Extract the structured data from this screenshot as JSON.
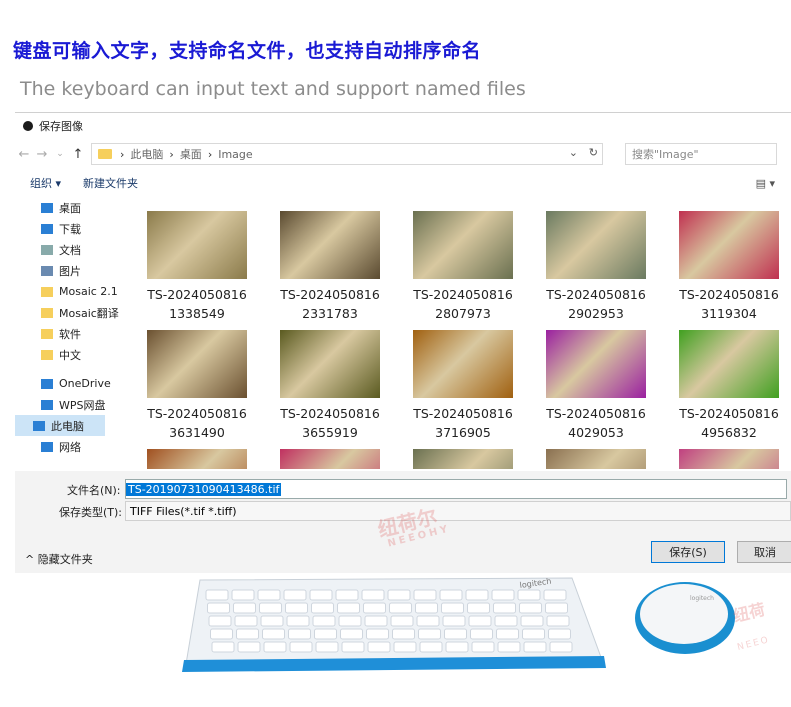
{
  "headline": "键盘可输入文字，支持命名文件，也支持自动排序命名",
  "subline": "The keyboard can input text and support named files",
  "dialog": {
    "title": "保存图像",
    "path": [
      "此电脑",
      "桌面",
      "Image"
    ],
    "search_placeholder": "搜索\"Image\"",
    "organize": "组织 ▾",
    "new_folder": "新建文件夹",
    "view_icon": "view-icon",
    "sidebar": [
      {
        "label": "桌面",
        "icon": "desktop-icon"
      },
      {
        "label": "下载",
        "icon": "download-icon"
      },
      {
        "label": "文档",
        "icon": "document-icon"
      },
      {
        "label": "图片",
        "icon": "picture-icon"
      },
      {
        "label": "Mosaic 2.1",
        "icon": "folder-icon"
      },
      {
        "label": "Mosaic翻译",
        "icon": "folder-icon"
      },
      {
        "label": "软件",
        "icon": "folder-icon"
      },
      {
        "label": "中文",
        "icon": "folder-icon"
      },
      {
        "label": "OneDrive",
        "icon": "cloud-icon"
      },
      {
        "label": "WPS网盘",
        "icon": "cloud-icon"
      },
      {
        "label": "此电脑",
        "icon": "pc-icon"
      },
      {
        "label": "网络",
        "icon": "network-icon"
      }
    ],
    "files": [
      {
        "line1": "TS-2024050816",
        "line2": "1338549",
        "color": "#8a7a4a"
      },
      {
        "line1": "TS-2024050816",
        "line2": "2331783",
        "color": "#5a4a30"
      },
      {
        "line1": "TS-2024050816",
        "line2": "2807973",
        "color": "#6a7050"
      },
      {
        "line1": "TS-2024050816",
        "line2": "2902953",
        "color": "#6a7a60"
      },
      {
        "line1": "TS-2024050816",
        "line2": "3119304",
        "color": "#c03050"
      },
      {
        "line1": "TS-2024050816",
        "line2": "3631490",
        "color": "#6a5030"
      },
      {
        "line1": "TS-2024050816",
        "line2": "3655919",
        "color": "#5a5a20"
      },
      {
        "line1": "TS-2024050816",
        "line2": "3716905",
        "color": "#a06010"
      },
      {
        "line1": "TS-2024050816",
        "line2": "4029053",
        "color": "#9a20a0"
      },
      {
        "line1": "TS-2024050816",
        "line2": "4956832",
        "color": "#40a020"
      },
      {
        "line1": "",
        "line2": "",
        "color": "#a05020"
      },
      {
        "line1": "",
        "line2": "",
        "color": "#c03060"
      },
      {
        "line1": "",
        "line2": "",
        "color": "#6a7050"
      },
      {
        "line1": "",
        "line2": "",
        "color": "#8a7050"
      },
      {
        "line1": "",
        "line2": "",
        "color": "#c04080"
      }
    ],
    "filename_label": "文件名(N):",
    "filename_value": "TS-20190731090413486.tif",
    "filetype_label": "保存类型(T):",
    "filetype_value": "TIFF Files(*.tif *.tiff)",
    "hide_folders": "隐藏文件夹",
    "save_button": "保存(S)",
    "cancel_button": "取消"
  },
  "watermark": {
    "cn": "纽荷尔",
    "en": "NEEOHY"
  },
  "keyboard_brand": "logitech"
}
